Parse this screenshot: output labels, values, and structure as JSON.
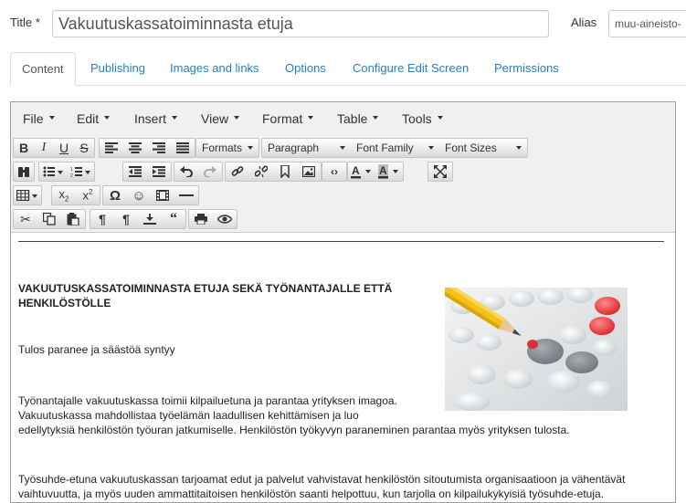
{
  "form": {
    "title_label": "Title *",
    "title_value": "Vakuutuskassatoiminnasta etuja",
    "alias_label": "Alias",
    "alias_value": "muu-aineisto-"
  },
  "tabs": [
    {
      "label": "Content",
      "active": true
    },
    {
      "label": "Publishing"
    },
    {
      "label": "Images and links"
    },
    {
      "label": "Options"
    },
    {
      "label": "Configure Edit Screen"
    },
    {
      "label": "Permissions"
    }
  ],
  "menubar": [
    "File",
    "Edit",
    "Insert",
    "View",
    "Format",
    "Table",
    "Tools"
  ],
  "toolbar": {
    "formats": "Formats",
    "block_format": "Paragraph",
    "font_family": "Font Family",
    "font_size": "Font Sizes"
  },
  "document": {
    "heading_line1": "VAKUUTUSKASSATOIMINNASTA ETUJA SEKÄ TYÖNANTAJALLE ETTÄ",
    "heading_line2": "HENKILÖSTÖLLE",
    "p1": "Tulos paranee ja säästöä syntyy",
    "p2_line1": "Työnantajalle vakuutuskassa toimii kilpailuetuna ja parantaa yrityksen imagoa.",
    "p2_line2": "Vakuutuskassa mahdollistaa työelämän laadullisen kehittämisen ja luo",
    "p2_line3": "edellytyksiä henkilöstön työuran jatkumiselle. Henkilöstön työkyvyn paraneminen parantaa myös yrityksen tulosta.",
    "p3_line1": "Työsuhde-etuna vakuutuskassan tarjoamat edut ja palvelut vahvistavat henkilöstön sitoutumista organisaatioon ja vähentävät",
    "p3_line2": "vaihtuvuutta, ja myös uuden ammattitaitoisen henkilöstön saanti helpottuu, kun tarjolla on kilpailukykyisiä työsuhde-etuja."
  },
  "colors": {
    "link": "#2a7fb8",
    "toolbar_bg": "#f0f0f0"
  }
}
